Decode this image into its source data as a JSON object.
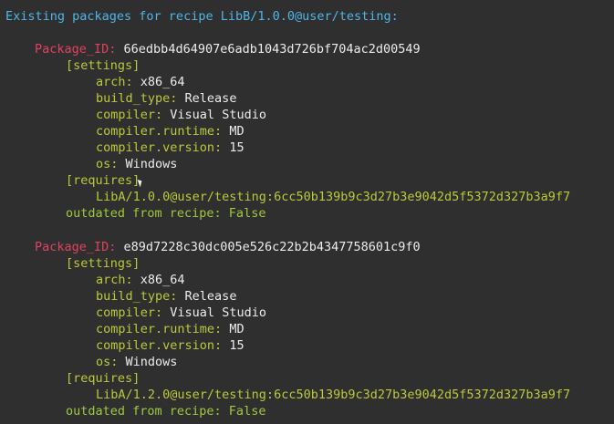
{
  "terminal": {
    "header": "Existing packages for recipe LibB/1.0.0@user/testing:",
    "packages": [
      {
        "id_label": "Package_ID:",
        "id_value": "66edbb4d64907e6adb1043d726bf704ac2d00549",
        "settings_label": "[settings]",
        "settings": [
          {
            "key": "arch:",
            "value": "x86_64"
          },
          {
            "key": "build_type:",
            "value": "Release"
          },
          {
            "key": "compiler:",
            "value": "Visual Studio"
          },
          {
            "key": "compiler.runtime:",
            "value": "MD"
          },
          {
            "key": "compiler.version:",
            "value": "15"
          },
          {
            "key": "os:",
            "value": "Windows"
          }
        ],
        "requires_label": "[requires]",
        "requires": "LibA/1.0.0@user/testing:6cc50b139b9c3d27b3e9042d5f5372d327b3a9f7",
        "outdated": "outdated from recipe: False"
      },
      {
        "id_label": "Package_ID:",
        "id_value": "e89d7228c30dc005e526c22b2b4347758601c9f0",
        "settings_label": "[settings]",
        "settings": [
          {
            "key": "arch:",
            "value": "x86_64"
          },
          {
            "key": "build_type:",
            "value": "Release"
          },
          {
            "key": "compiler:",
            "value": "Visual Studio"
          },
          {
            "key": "compiler.runtime:",
            "value": "MD"
          },
          {
            "key": "compiler.version:",
            "value": "15"
          },
          {
            "key": "os:",
            "value": "Windows"
          }
        ],
        "requires_label": "[requires]",
        "requires": "LibA/1.2.0@user/testing:6cc50b139b9c3d27b3e9042d5f5372d327b3a9f7",
        "outdated": "outdated from recipe: False"
      }
    ]
  }
}
